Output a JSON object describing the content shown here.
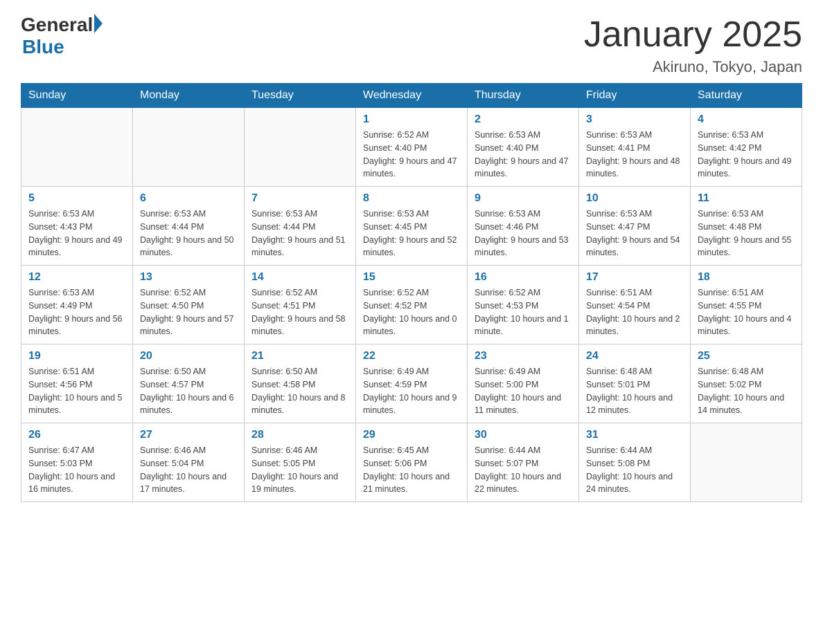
{
  "header": {
    "logo": {
      "general": "General",
      "arrow": "▶",
      "blue": "Blue"
    },
    "title": "January 2025",
    "subtitle": "Akiruno, Tokyo, Japan"
  },
  "weekdays": [
    "Sunday",
    "Monday",
    "Tuesday",
    "Wednesday",
    "Thursday",
    "Friday",
    "Saturday"
  ],
  "weeks": [
    [
      {
        "day": "",
        "info": ""
      },
      {
        "day": "",
        "info": ""
      },
      {
        "day": "",
        "info": ""
      },
      {
        "day": "1",
        "info": "Sunrise: 6:52 AM\nSunset: 4:40 PM\nDaylight: 9 hours and 47 minutes."
      },
      {
        "day": "2",
        "info": "Sunrise: 6:53 AM\nSunset: 4:40 PM\nDaylight: 9 hours and 47 minutes."
      },
      {
        "day": "3",
        "info": "Sunrise: 6:53 AM\nSunset: 4:41 PM\nDaylight: 9 hours and 48 minutes."
      },
      {
        "day": "4",
        "info": "Sunrise: 6:53 AM\nSunset: 4:42 PM\nDaylight: 9 hours and 49 minutes."
      }
    ],
    [
      {
        "day": "5",
        "info": "Sunrise: 6:53 AM\nSunset: 4:43 PM\nDaylight: 9 hours and 49 minutes."
      },
      {
        "day": "6",
        "info": "Sunrise: 6:53 AM\nSunset: 4:44 PM\nDaylight: 9 hours and 50 minutes."
      },
      {
        "day": "7",
        "info": "Sunrise: 6:53 AM\nSunset: 4:44 PM\nDaylight: 9 hours and 51 minutes."
      },
      {
        "day": "8",
        "info": "Sunrise: 6:53 AM\nSunset: 4:45 PM\nDaylight: 9 hours and 52 minutes."
      },
      {
        "day": "9",
        "info": "Sunrise: 6:53 AM\nSunset: 4:46 PM\nDaylight: 9 hours and 53 minutes."
      },
      {
        "day": "10",
        "info": "Sunrise: 6:53 AM\nSunset: 4:47 PM\nDaylight: 9 hours and 54 minutes."
      },
      {
        "day": "11",
        "info": "Sunrise: 6:53 AM\nSunset: 4:48 PM\nDaylight: 9 hours and 55 minutes."
      }
    ],
    [
      {
        "day": "12",
        "info": "Sunrise: 6:53 AM\nSunset: 4:49 PM\nDaylight: 9 hours and 56 minutes."
      },
      {
        "day": "13",
        "info": "Sunrise: 6:52 AM\nSunset: 4:50 PM\nDaylight: 9 hours and 57 minutes."
      },
      {
        "day": "14",
        "info": "Sunrise: 6:52 AM\nSunset: 4:51 PM\nDaylight: 9 hours and 58 minutes."
      },
      {
        "day": "15",
        "info": "Sunrise: 6:52 AM\nSunset: 4:52 PM\nDaylight: 10 hours and 0 minutes."
      },
      {
        "day": "16",
        "info": "Sunrise: 6:52 AM\nSunset: 4:53 PM\nDaylight: 10 hours and 1 minute."
      },
      {
        "day": "17",
        "info": "Sunrise: 6:51 AM\nSunset: 4:54 PM\nDaylight: 10 hours and 2 minutes."
      },
      {
        "day": "18",
        "info": "Sunrise: 6:51 AM\nSunset: 4:55 PM\nDaylight: 10 hours and 4 minutes."
      }
    ],
    [
      {
        "day": "19",
        "info": "Sunrise: 6:51 AM\nSunset: 4:56 PM\nDaylight: 10 hours and 5 minutes."
      },
      {
        "day": "20",
        "info": "Sunrise: 6:50 AM\nSunset: 4:57 PM\nDaylight: 10 hours and 6 minutes."
      },
      {
        "day": "21",
        "info": "Sunrise: 6:50 AM\nSunset: 4:58 PM\nDaylight: 10 hours and 8 minutes."
      },
      {
        "day": "22",
        "info": "Sunrise: 6:49 AM\nSunset: 4:59 PM\nDaylight: 10 hours and 9 minutes."
      },
      {
        "day": "23",
        "info": "Sunrise: 6:49 AM\nSunset: 5:00 PM\nDaylight: 10 hours and 11 minutes."
      },
      {
        "day": "24",
        "info": "Sunrise: 6:48 AM\nSunset: 5:01 PM\nDaylight: 10 hours and 12 minutes."
      },
      {
        "day": "25",
        "info": "Sunrise: 6:48 AM\nSunset: 5:02 PM\nDaylight: 10 hours and 14 minutes."
      }
    ],
    [
      {
        "day": "26",
        "info": "Sunrise: 6:47 AM\nSunset: 5:03 PM\nDaylight: 10 hours and 16 minutes."
      },
      {
        "day": "27",
        "info": "Sunrise: 6:46 AM\nSunset: 5:04 PM\nDaylight: 10 hours and 17 minutes."
      },
      {
        "day": "28",
        "info": "Sunrise: 6:46 AM\nSunset: 5:05 PM\nDaylight: 10 hours and 19 minutes."
      },
      {
        "day": "29",
        "info": "Sunrise: 6:45 AM\nSunset: 5:06 PM\nDaylight: 10 hours and 21 minutes."
      },
      {
        "day": "30",
        "info": "Sunrise: 6:44 AM\nSunset: 5:07 PM\nDaylight: 10 hours and 22 minutes."
      },
      {
        "day": "31",
        "info": "Sunrise: 6:44 AM\nSunset: 5:08 PM\nDaylight: 10 hours and 24 minutes."
      },
      {
        "day": "",
        "info": ""
      }
    ]
  ]
}
